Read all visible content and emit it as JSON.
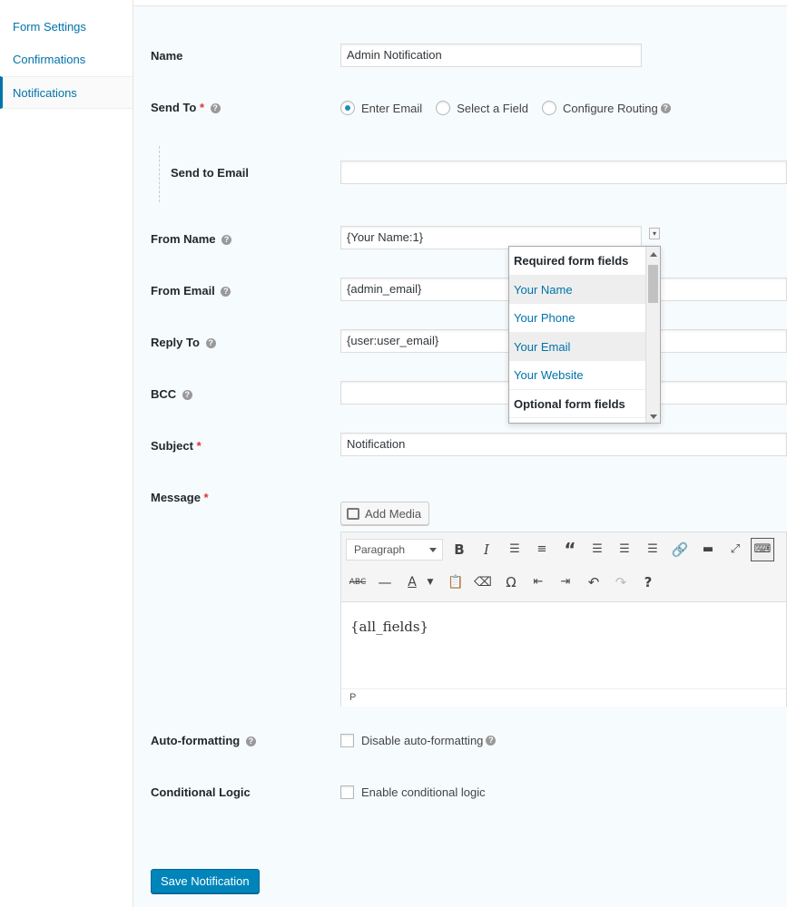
{
  "sidebar": {
    "items": [
      {
        "label": "Form Settings"
      },
      {
        "label": "Confirmations"
      },
      {
        "label": "Notifications"
      }
    ]
  },
  "form": {
    "name_label": "Name",
    "name_value": "Admin Notification",
    "send_to_label": "Send To",
    "send_to_required": "*",
    "send_to_options": [
      "Enter Email",
      "Select a Field",
      "Configure Routing"
    ],
    "send_to_selected": "Enter Email",
    "send_to_email_label": "Send to Email",
    "send_to_email_value": "",
    "from_name_label": "From Name",
    "from_name_value": "{Your Name:1}",
    "from_email_label": "From Email",
    "from_email_value": "{admin_email}",
    "reply_to_label": "Reply To",
    "reply_to_value": "{user:user_email}",
    "bcc_label": "BCC",
    "bcc_value": "",
    "subject_label": "Subject",
    "subject_required": "*",
    "subject_value": "Notification",
    "message_label": "Message",
    "message_required": "*",
    "auto_formatting_label": "Auto-formatting",
    "disable_auto_formatting": "Disable auto-formatting",
    "conditional_logic_label": "Conditional Logic",
    "enable_conditional_logic": "Enable conditional logic"
  },
  "merge_dropdown": {
    "items": [
      {
        "label": "Required form fields",
        "type": "header"
      },
      {
        "label": "Your Name",
        "type": "option"
      },
      {
        "label": "Your Phone",
        "type": "option"
      },
      {
        "label": "Your Email",
        "type": "option"
      },
      {
        "label": "Your Website",
        "type": "option"
      },
      {
        "label": "Optional form fields",
        "type": "header"
      }
    ]
  },
  "editor": {
    "add_media_label": "Add Media",
    "format_select": "Paragraph",
    "content": "{all_fields}",
    "status_path": "P"
  },
  "actions": {
    "save_label": "Save Notification"
  },
  "colors": {
    "accent": "#0073aa",
    "primary_button": "#0085ba",
    "required": "#dd3333",
    "panel_bg": "#f6fbfd"
  }
}
